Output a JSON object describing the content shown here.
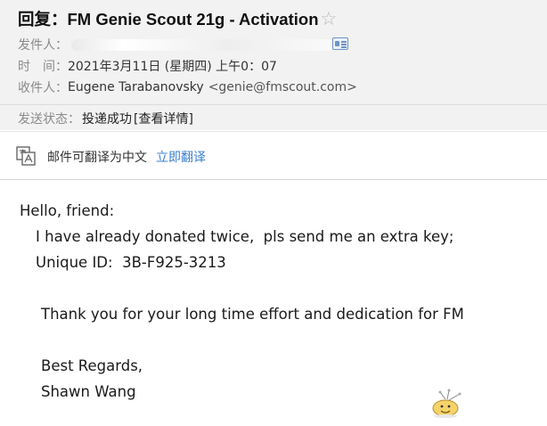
{
  "header": {
    "subject": "回复：FM Genie Scout 21g - Activation",
    "star_icon": "star-outline-icon",
    "sender_label": "发件人：",
    "time_label": "时　间：",
    "time_value": "2021年3月11日 (星期四) 上午0：07",
    "recipient_label": "收件人：",
    "recipient_name": "Eugene Tarabanovsky",
    "recipient_email": "<genie@fmscout.com>",
    "status_label": "发送状态：",
    "status_value": "投递成功",
    "status_details": "[查看详情]"
  },
  "translate_bar": {
    "icon": "translate-icon",
    "text": "邮件可翻译为中文",
    "link": "立即翻译"
  },
  "body": {
    "greeting": "Hello, friend:",
    "line1": "I have already donated twice,  pls send me an extra key;",
    "line2": "Unique ID:  3B-F925-3213",
    "line3": "Thank you for your long time effort and dedication for FM",
    "closing": "Best Regards,",
    "signature": "Shawn Wang"
  },
  "colors": {
    "header_bg": "#f2f2f2",
    "link_blue": "#3a7fd0",
    "label_gray": "#8a8a8a"
  }
}
